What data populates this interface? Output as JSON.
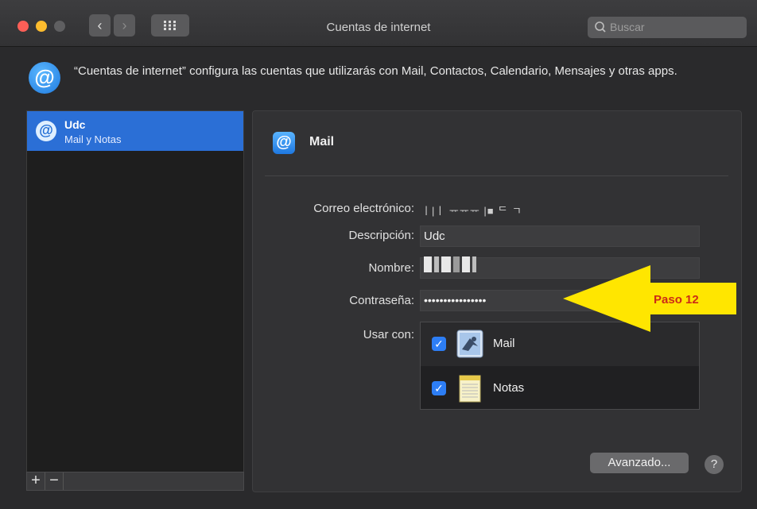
{
  "window": {
    "title": "Cuentas de internet",
    "search_placeholder": "Buscar"
  },
  "header": {
    "icon": "at-sign-icon",
    "description": "“Cuentas de internet” configura las cuentas que utilizarás con Mail, Contactos, Calendario, Mensajes y otras apps."
  },
  "sidebar": {
    "accounts": [
      {
        "name": "Udc",
        "subtitle": "Mail y Notas",
        "selected": true
      }
    ],
    "add_label": "+",
    "remove_label": "−"
  },
  "panel": {
    "title": "Mail",
    "email_label": "Correo electrónico:",
    "email_value": "ㅣ|ㅣ ᅲᅲᅲ |■ ᄃ ㄱ",
    "description_label": "Descripción:",
    "description_value": "Udc",
    "name_label": "Nombre:",
    "password_label": "Contraseña:",
    "password_value": "••••••••••••••••",
    "usar_label": "Usar con:",
    "apps": [
      {
        "name": "Mail",
        "checked": true,
        "icon": "mail-app-icon"
      },
      {
        "name": "Notas",
        "checked": true,
        "icon": "notes-app-icon"
      }
    ],
    "advanced_label": "Avanzado...",
    "help_label": "?"
  },
  "annotation": {
    "text": "Paso 12",
    "arrow_color": "#ffe600",
    "text_color": "#cc2b16"
  },
  "colors": {
    "accent": "#2b6fd6",
    "checkbox": "#2d7ef5"
  }
}
